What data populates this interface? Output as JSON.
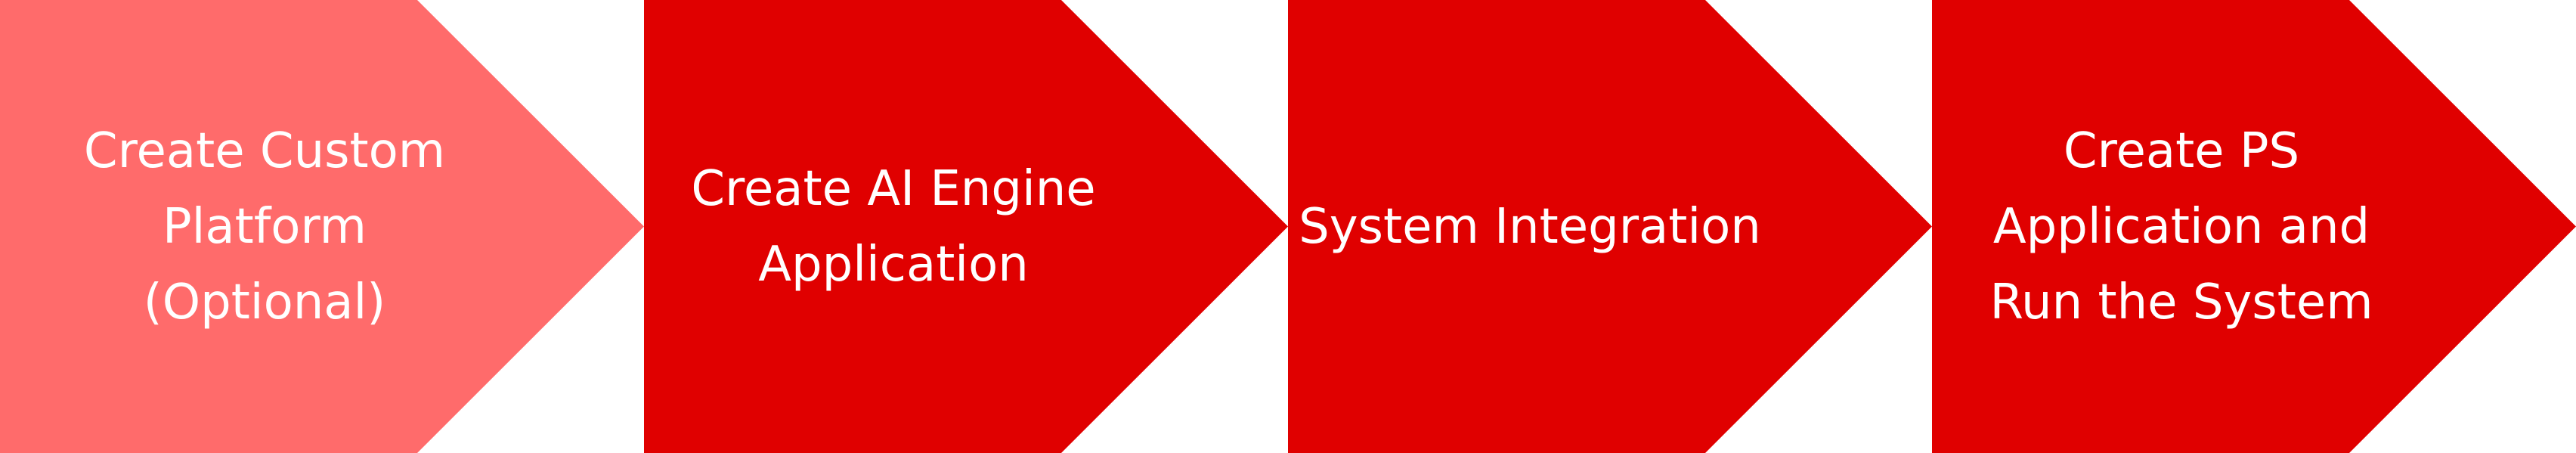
{
  "process": {
    "steps": [
      {
        "label": "Create Custom\nPlatform\n(Optional)",
        "fill": "#FF6B6B"
      },
      {
        "label": "Create AI Engine\nApplication",
        "fill": "#E00000"
      },
      {
        "label": "System Integration",
        "fill": "#E00000"
      },
      {
        "label": "Create PS\nApplication and\nRun the System",
        "fill": "#E00000"
      }
    ]
  }
}
